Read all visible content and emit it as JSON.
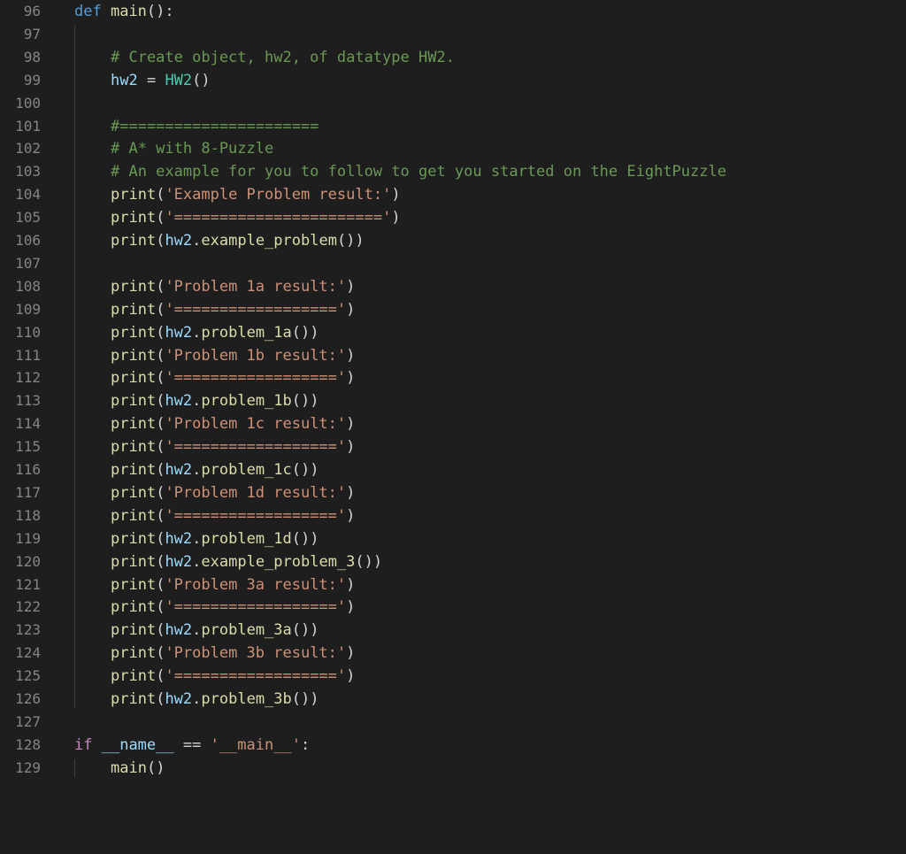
{
  "colors": {
    "background": "#1e1e1e",
    "line_number": "#858585",
    "keyword": "#569cd6",
    "control": "#c586c0",
    "function": "#dcdcaa",
    "variable": "#9cdcfe",
    "class": "#4ec9b0",
    "string": "#ce9178",
    "comment": "#6a9955",
    "text": "#d4d4d4",
    "indent_guide": "#404040"
  },
  "lines": [
    {
      "num": "96",
      "indent": 0,
      "tokens": [
        {
          "t": "kw",
          "v": "def"
        },
        {
          "t": "pun",
          "v": " "
        },
        {
          "t": "fn",
          "v": "main"
        },
        {
          "t": "pun",
          "v": "():"
        }
      ]
    },
    {
      "num": "97",
      "indent": 0,
      "tokens": []
    },
    {
      "num": "98",
      "indent": 1,
      "tokens": [
        {
          "t": "cmt",
          "v": "# Create object, hw2, of datatype HW2."
        }
      ]
    },
    {
      "num": "99",
      "indent": 1,
      "tokens": [
        {
          "t": "var",
          "v": "hw2"
        },
        {
          "t": "pun",
          "v": " = "
        },
        {
          "t": "cls",
          "v": "HW2"
        },
        {
          "t": "pun",
          "v": "()"
        }
      ]
    },
    {
      "num": "100",
      "indent": 0,
      "tokens": []
    },
    {
      "num": "101",
      "indent": 1,
      "tokens": [
        {
          "t": "cmt",
          "v": "#======================"
        }
      ]
    },
    {
      "num": "102",
      "indent": 1,
      "tokens": [
        {
          "t": "cmt",
          "v": "# A* with 8-Puzzle"
        }
      ]
    },
    {
      "num": "103",
      "indent": 1,
      "tokens": [
        {
          "t": "cmt",
          "v": "# An example for you to follow to get you started on the EightPuzzle"
        }
      ]
    },
    {
      "num": "104",
      "indent": 1,
      "tokens": [
        {
          "t": "fn",
          "v": "print"
        },
        {
          "t": "pun",
          "v": "("
        },
        {
          "t": "str",
          "v": "'Example Problem result:'"
        },
        {
          "t": "pun",
          "v": ")"
        }
      ]
    },
    {
      "num": "105",
      "indent": 1,
      "tokens": [
        {
          "t": "fn",
          "v": "print"
        },
        {
          "t": "pun",
          "v": "("
        },
        {
          "t": "str",
          "v": "'======================='"
        },
        {
          "t": "pun",
          "v": ")"
        }
      ]
    },
    {
      "num": "106",
      "indent": 1,
      "tokens": [
        {
          "t": "fn",
          "v": "print"
        },
        {
          "t": "pun",
          "v": "("
        },
        {
          "t": "var",
          "v": "hw2"
        },
        {
          "t": "pun",
          "v": "."
        },
        {
          "t": "fn",
          "v": "example_problem"
        },
        {
          "t": "pun",
          "v": "())"
        }
      ]
    },
    {
      "num": "107",
      "indent": 0,
      "tokens": []
    },
    {
      "num": "108",
      "indent": 1,
      "tokens": [
        {
          "t": "fn",
          "v": "print"
        },
        {
          "t": "pun",
          "v": "("
        },
        {
          "t": "str",
          "v": "'Problem 1a result:'"
        },
        {
          "t": "pun",
          "v": ")"
        }
      ]
    },
    {
      "num": "109",
      "indent": 1,
      "tokens": [
        {
          "t": "fn",
          "v": "print"
        },
        {
          "t": "pun",
          "v": "("
        },
        {
          "t": "str",
          "v": "'=================='"
        },
        {
          "t": "pun",
          "v": ")"
        }
      ]
    },
    {
      "num": "110",
      "indent": 1,
      "tokens": [
        {
          "t": "fn",
          "v": "print"
        },
        {
          "t": "pun",
          "v": "("
        },
        {
          "t": "var",
          "v": "hw2"
        },
        {
          "t": "pun",
          "v": "."
        },
        {
          "t": "fn",
          "v": "problem_1a"
        },
        {
          "t": "pun",
          "v": "())"
        }
      ]
    },
    {
      "num": "111",
      "indent": 1,
      "tokens": [
        {
          "t": "fn",
          "v": "print"
        },
        {
          "t": "pun",
          "v": "("
        },
        {
          "t": "str",
          "v": "'Problem 1b result:'"
        },
        {
          "t": "pun",
          "v": ")"
        }
      ]
    },
    {
      "num": "112",
      "indent": 1,
      "tokens": [
        {
          "t": "fn",
          "v": "print"
        },
        {
          "t": "pun",
          "v": "("
        },
        {
          "t": "str",
          "v": "'=================='"
        },
        {
          "t": "pun",
          "v": ")"
        }
      ]
    },
    {
      "num": "113",
      "indent": 1,
      "tokens": [
        {
          "t": "fn",
          "v": "print"
        },
        {
          "t": "pun",
          "v": "("
        },
        {
          "t": "var",
          "v": "hw2"
        },
        {
          "t": "pun",
          "v": "."
        },
        {
          "t": "fn",
          "v": "problem_1b"
        },
        {
          "t": "pun",
          "v": "())"
        }
      ]
    },
    {
      "num": "114",
      "indent": 1,
      "tokens": [
        {
          "t": "fn",
          "v": "print"
        },
        {
          "t": "pun",
          "v": "("
        },
        {
          "t": "str",
          "v": "'Problem 1c result:'"
        },
        {
          "t": "pun",
          "v": ")"
        }
      ]
    },
    {
      "num": "115",
      "indent": 1,
      "tokens": [
        {
          "t": "fn",
          "v": "print"
        },
        {
          "t": "pun",
          "v": "("
        },
        {
          "t": "str",
          "v": "'=================='"
        },
        {
          "t": "pun",
          "v": ")"
        }
      ]
    },
    {
      "num": "116",
      "indent": 1,
      "tokens": [
        {
          "t": "fn",
          "v": "print"
        },
        {
          "t": "pun",
          "v": "("
        },
        {
          "t": "var",
          "v": "hw2"
        },
        {
          "t": "pun",
          "v": "."
        },
        {
          "t": "fn",
          "v": "problem_1c"
        },
        {
          "t": "pun",
          "v": "())"
        }
      ]
    },
    {
      "num": "117",
      "indent": 1,
      "tokens": [
        {
          "t": "fn",
          "v": "print"
        },
        {
          "t": "pun",
          "v": "("
        },
        {
          "t": "str",
          "v": "'Problem 1d result:'"
        },
        {
          "t": "pun",
          "v": ")"
        }
      ]
    },
    {
      "num": "118",
      "indent": 1,
      "tokens": [
        {
          "t": "fn",
          "v": "print"
        },
        {
          "t": "pun",
          "v": "("
        },
        {
          "t": "str",
          "v": "'=================='"
        },
        {
          "t": "pun",
          "v": ")"
        }
      ]
    },
    {
      "num": "119",
      "indent": 1,
      "tokens": [
        {
          "t": "fn",
          "v": "print"
        },
        {
          "t": "pun",
          "v": "("
        },
        {
          "t": "var",
          "v": "hw2"
        },
        {
          "t": "pun",
          "v": "."
        },
        {
          "t": "fn",
          "v": "problem_1d"
        },
        {
          "t": "pun",
          "v": "())"
        }
      ]
    },
    {
      "num": "120",
      "indent": 1,
      "tokens": [
        {
          "t": "fn",
          "v": "print"
        },
        {
          "t": "pun",
          "v": "("
        },
        {
          "t": "var",
          "v": "hw2"
        },
        {
          "t": "pun",
          "v": "."
        },
        {
          "t": "fn",
          "v": "example_problem_3"
        },
        {
          "t": "pun",
          "v": "())"
        }
      ]
    },
    {
      "num": "121",
      "indent": 1,
      "tokens": [
        {
          "t": "fn",
          "v": "print"
        },
        {
          "t": "pun",
          "v": "("
        },
        {
          "t": "str",
          "v": "'Problem 3a result:'"
        },
        {
          "t": "pun",
          "v": ")"
        }
      ]
    },
    {
      "num": "122",
      "indent": 1,
      "tokens": [
        {
          "t": "fn",
          "v": "print"
        },
        {
          "t": "pun",
          "v": "("
        },
        {
          "t": "str",
          "v": "'=================='"
        },
        {
          "t": "pun",
          "v": ")"
        }
      ]
    },
    {
      "num": "123",
      "indent": 1,
      "tokens": [
        {
          "t": "fn",
          "v": "print"
        },
        {
          "t": "pun",
          "v": "("
        },
        {
          "t": "var",
          "v": "hw2"
        },
        {
          "t": "pun",
          "v": "."
        },
        {
          "t": "fn",
          "v": "problem_3a"
        },
        {
          "t": "pun",
          "v": "())"
        }
      ]
    },
    {
      "num": "124",
      "indent": 1,
      "tokens": [
        {
          "t": "fn",
          "v": "print"
        },
        {
          "t": "pun",
          "v": "("
        },
        {
          "t": "str",
          "v": "'Problem 3b result:'"
        },
        {
          "t": "pun",
          "v": ")"
        }
      ]
    },
    {
      "num": "125",
      "indent": 1,
      "tokens": [
        {
          "t": "fn",
          "v": "print"
        },
        {
          "t": "pun",
          "v": "("
        },
        {
          "t": "str",
          "v": "'=================='"
        },
        {
          "t": "pun",
          "v": ")"
        }
      ]
    },
    {
      "num": "126",
      "indent": 1,
      "tokens": [
        {
          "t": "fn",
          "v": "print"
        },
        {
          "t": "pun",
          "v": "("
        },
        {
          "t": "var",
          "v": "hw2"
        },
        {
          "t": "pun",
          "v": "."
        },
        {
          "t": "fn",
          "v": "problem_3b"
        },
        {
          "t": "pun",
          "v": "())"
        }
      ]
    },
    {
      "num": "127",
      "indent": 0,
      "tokens": []
    },
    {
      "num": "128",
      "indent": 0,
      "tokens": [
        {
          "t": "ctl",
          "v": "if"
        },
        {
          "t": "pun",
          "v": " "
        },
        {
          "t": "var",
          "v": "__name__"
        },
        {
          "t": "pun",
          "v": " == "
        },
        {
          "t": "str",
          "v": "'__main__'"
        },
        {
          "t": "pun",
          "v": ":"
        }
      ]
    },
    {
      "num": "129",
      "indent": 1,
      "tokens": [
        {
          "t": "fn",
          "v": "main"
        },
        {
          "t": "pun",
          "v": "()"
        }
      ]
    }
  ]
}
